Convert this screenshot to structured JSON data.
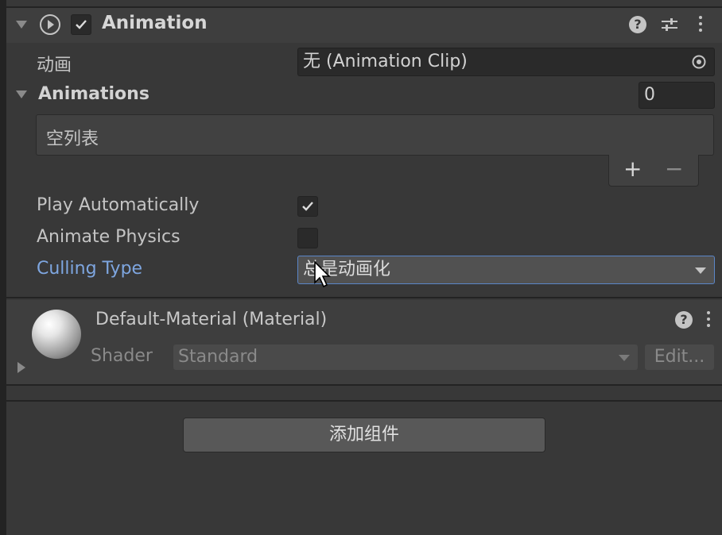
{
  "component": {
    "title": "Animation",
    "enabled": true,
    "help_icon": "help-icon",
    "preset_icon": "sliders-icon",
    "menu_icon": "kebab-menu-icon"
  },
  "fields": {
    "animation_label": "动画",
    "animation_value": "无 (Animation Clip)",
    "animations_label": "Animations",
    "animations_count": "0",
    "list_empty": "空列表",
    "add_symbol": "+",
    "remove_symbol": "−",
    "play_auto_label": "Play Automatically",
    "play_auto_checked": true,
    "animate_physics_label": "Animate Physics",
    "animate_physics_checked": false,
    "culling_label": "Culling Type",
    "culling_value": "总是动画化"
  },
  "material": {
    "title": "Default-Material (Material)",
    "shader_label": "Shader",
    "shader_value": "Standard",
    "edit_label": "Edit..."
  },
  "add_component_label": "添加组件",
  "colors": {
    "accent_label": "#7ea6e0",
    "focus_border": "#5a86c8"
  }
}
